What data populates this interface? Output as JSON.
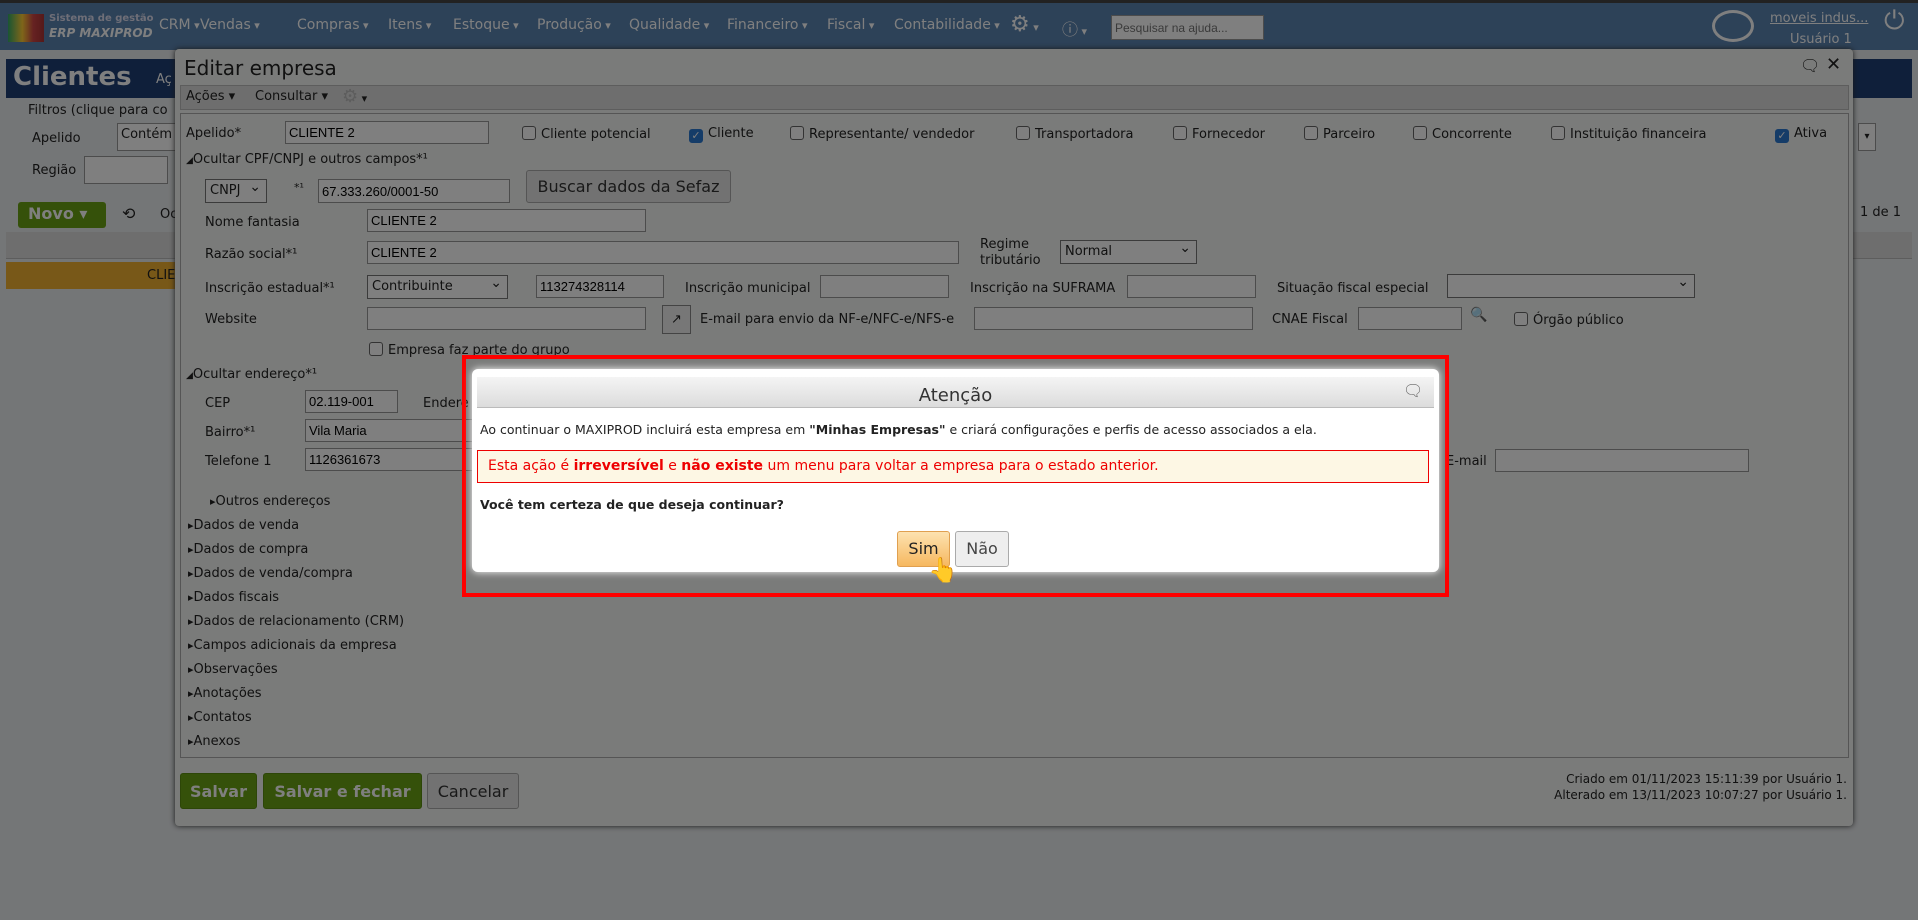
{
  "topbar": {
    "logo_line1": "Sistema de gestão",
    "logo_line2": "ERP MAXIPROD",
    "menus": [
      "CRM",
      "Vendas",
      "Compras",
      "Itens",
      "Estoque",
      "Produção",
      "Qualidade",
      "Financeiro",
      "Fiscal",
      "Contabilidade"
    ],
    "search_placeholder": "Pesquisar na ajuda...",
    "company": "moveis indus...",
    "user": "Usuário 1"
  },
  "background": {
    "title": "Clientes",
    "actions": "Aç",
    "filters": "Filtros (clique para co",
    "apelido": "Apelido",
    "contem": "Contém",
    "regiao": "Região",
    "novo": "Novo",
    "oc": "Oc",
    "row_name": "CLIE",
    "pagination": "1 de 1"
  },
  "edit": {
    "title": "Editar empresa",
    "toolbar": [
      "Ações",
      "Consultar"
    ],
    "apelido_label": "Apelido*",
    "apelido": "CLIENTE 2",
    "checks": [
      {
        "label": "Cliente potencial",
        "checked": false
      },
      {
        "label": "Cliente",
        "checked": true
      },
      {
        "label": "Representante/ vendedor",
        "checked": false
      },
      {
        "label": "Transportadora",
        "checked": false
      },
      {
        "label": "Fornecedor",
        "checked": false
      },
      {
        "label": "Parceiro",
        "checked": false
      },
      {
        "label": "Concorrente",
        "checked": false
      },
      {
        "label": "Instituição financeira",
        "checked": false
      },
      {
        "label": "Ativa",
        "checked": true
      }
    ],
    "hide_cpf": "Ocultar CPF/CNPJ e outros campos*¹",
    "doc_type": "CNPJ",
    "req": "*¹",
    "cnpj": "67.333.260/0001-50",
    "buscar": "Buscar dados da Sefaz",
    "nome_fantasia_label": "Nome fantasia",
    "nome_fantasia": "CLIENTE 2",
    "razao_label": "Razão social*¹",
    "razao": "CLIENTE 2",
    "regime_label1": "Regime",
    "regime_label2": "tributário",
    "regime": "Normal",
    "ie_label": "Inscrição estadual*¹",
    "ie_type": "Contribuinte",
    "ie": "113274328114",
    "im_label": "Inscrição municipal",
    "suframa_label": "Inscrição na SUFRAMA",
    "situacao_label": "Situação fiscal especial",
    "website_label": "Website",
    "email_nf_label": "E-mail para envio da NF-e/NFC-e/NFS-e",
    "cnae_label": "CNAE Fiscal",
    "orgao_label": "Órgão público",
    "grupo_label": "Empresa faz parte do grupo",
    "hide_end": "Ocultar endereço*¹",
    "cep_label": "CEP",
    "cep": "02.119-001",
    "end_label": "Endere",
    "bairro_label": "Bairro*¹",
    "bairro": "Vila Maria",
    "tel_label": "Telefone 1",
    "tel": "1126361673",
    "email_label": "E-mail",
    "outros": "Outros endereços",
    "sections": [
      "Dados de venda",
      "Dados de compra",
      "Dados de venda/compra",
      "Dados fiscais",
      "Dados de relacionamento (CRM)",
      "Campos adicionais da empresa",
      "Observações",
      "Anotações",
      "Contatos",
      "Anexos"
    ],
    "salvar": "Salvar",
    "salvar_fechar": "Salvar e fechar",
    "cancelar": "Cancelar",
    "created": "Criado em 01/11/2023 15:11:39 por Usuário 1.",
    "altered": "Alterado em 13/11/2023 10:07:27 por Usuário 1."
  },
  "confirm": {
    "title": "Atenção",
    "msg_pre": "Ao continuar o MAXIPROD incluirá esta empresa em ",
    "msg_bold": "\"Minhas Empresas\"",
    "msg_post": " e criará configurações e perfis de acesso associados a ela.",
    "warn_1": "Esta ação é ",
    "warn_b1": "irreversível",
    "warn_2": " e ",
    "warn_b2": "não existe",
    "warn_3": " um menu para voltar a empresa para o estado anterior.",
    "question": "Você tem certeza de que deseja continuar?",
    "yes": "Sim",
    "no": "Não"
  }
}
